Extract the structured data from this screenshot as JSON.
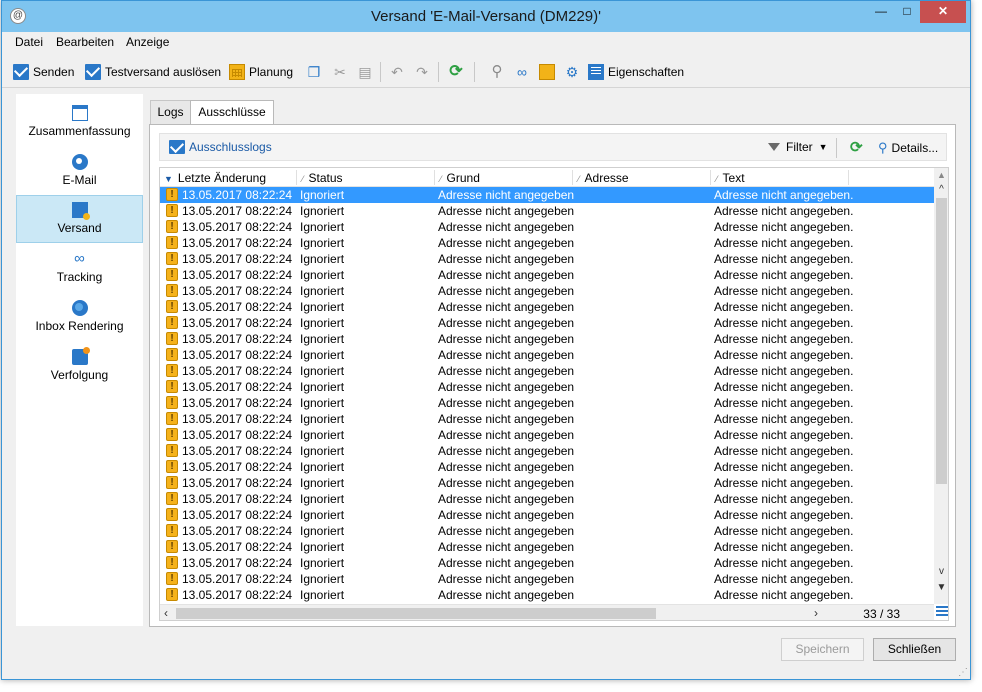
{
  "window": {
    "title": "Versand 'E-Mail-Versand (DM229)'",
    "controls": {
      "minimize": "—",
      "maximize": "□",
      "close": "✕"
    }
  },
  "menu": [
    "Datei",
    "Bearbeiten",
    "Anzeige"
  ],
  "toolbar": {
    "send": "Senden",
    "test_send": "Testversand auslösen",
    "planning": "Planung",
    "properties": "Eigenschaften"
  },
  "sidebar": {
    "items": [
      {
        "label": "Zusammenfassung",
        "icon": "summary-icon"
      },
      {
        "label": "E-Mail",
        "icon": "email-icon"
      },
      {
        "label": "Versand",
        "icon": "delivery-icon",
        "active": true
      },
      {
        "label": "Tracking",
        "icon": "tracking-icon"
      },
      {
        "label": "Inbox Rendering",
        "icon": "inbox-rendering-icon"
      },
      {
        "label": "Verfolgung",
        "icon": "audit-icon"
      }
    ]
  },
  "tabs": [
    {
      "label": "Logs",
      "active": false
    },
    {
      "label": "Ausschlüsse",
      "active": true
    }
  ],
  "subbar": {
    "link": "Ausschlusslogs",
    "filter": "Filter",
    "details": "Details..."
  },
  "grid": {
    "columns": [
      "Letzte Änderung",
      "Status",
      "Grund",
      "Adresse",
      "Text"
    ],
    "row_template": {
      "date": "13.05.2017 08:22:24",
      "status": "Ignoriert",
      "reason": "Adresse nicht angegeben",
      "address": "",
      "text": "Adresse nicht angegeben."
    },
    "visible_rows": 26,
    "selected_row": 0,
    "counter": "33 / 33"
  },
  "buttons": {
    "save": "Speichern",
    "close": "Schließen"
  },
  "colors": {
    "titlebar": "#7ec4ef",
    "selection": "#3399ff",
    "accent": "#2a78c8",
    "warning": "#f5b21b"
  }
}
